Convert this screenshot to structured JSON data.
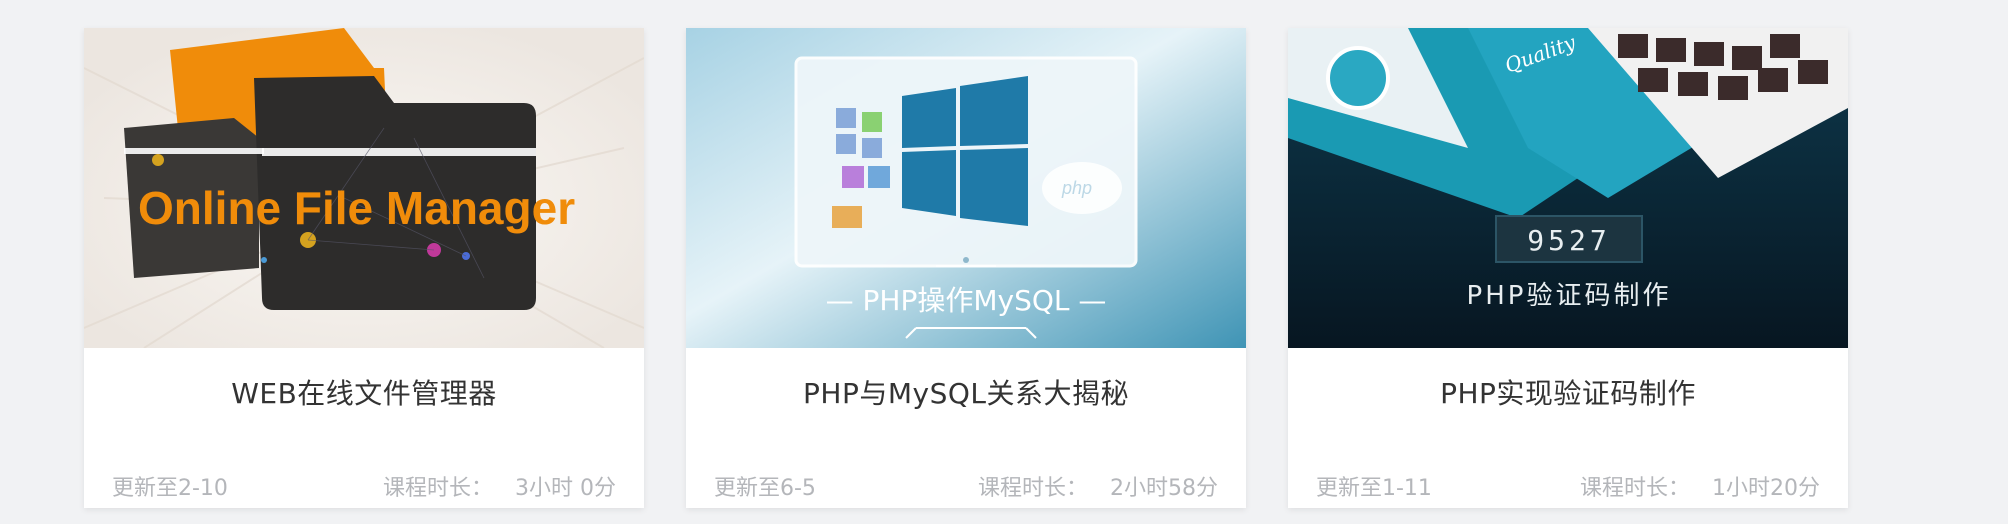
{
  "courses": [
    {
      "thumbnail_text": "Online File Manager",
      "title": "WEB在线文件管理器",
      "updated": "更新至2-10",
      "duration_label": "课程时长：",
      "duration_value": "3小时 0分"
    },
    {
      "thumbnail_text": "— PHP操作MySQL —",
      "title": "PHP与MySQL关系大揭秘",
      "updated": "更新至6-5",
      "duration_label": "课程时长：",
      "duration_value": "2小时58分"
    },
    {
      "thumbnail_text": "9527",
      "thumbnail_subtext": "PHP验证码制作",
      "title": "PHP实现验证码制作",
      "updated": "更新至1-11",
      "duration_label": "课程时长：",
      "duration_value": "1小时20分"
    }
  ]
}
